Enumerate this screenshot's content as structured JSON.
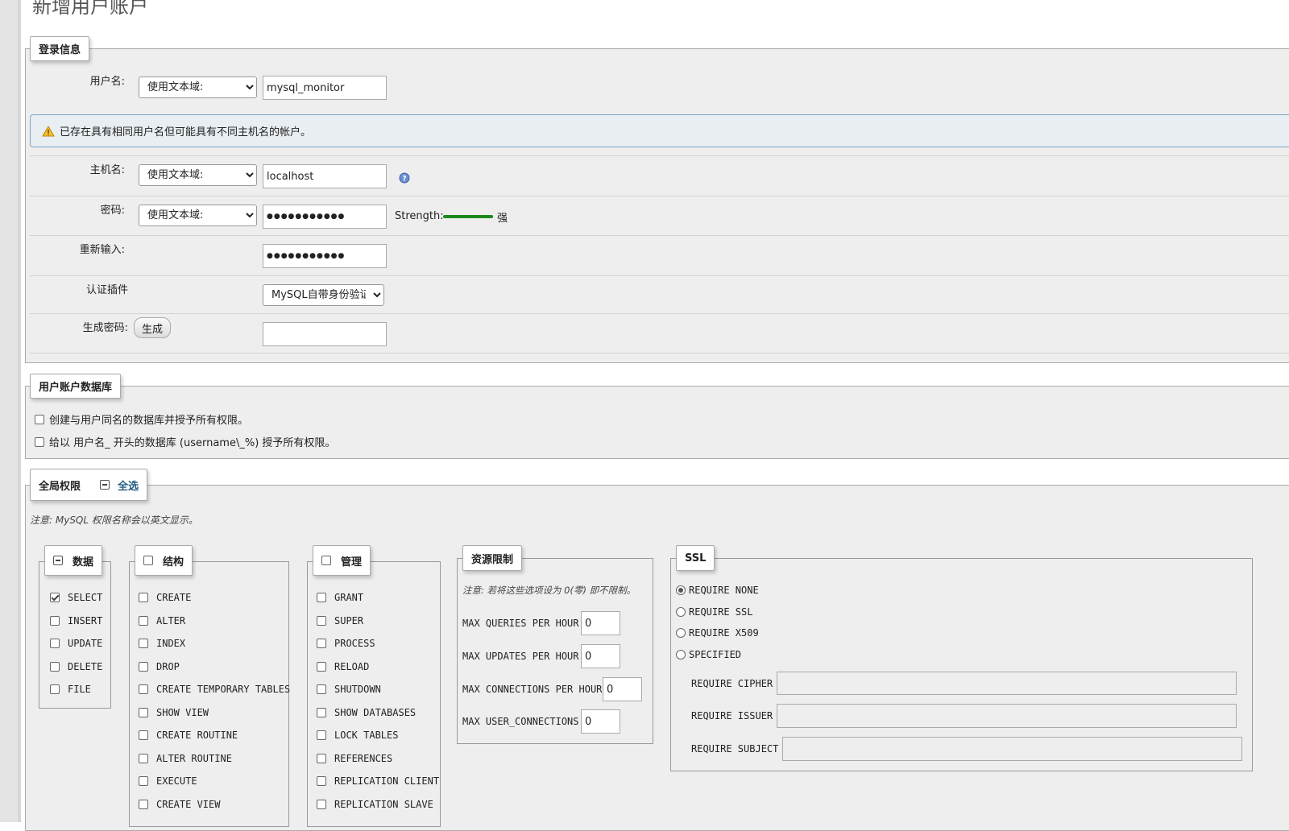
{
  "page": {
    "title": "新增用户账户"
  },
  "login": {
    "legend": "登录信息",
    "username_label": "用户名:",
    "username_mode": "使用文本域:",
    "username_value": "mysql_monitor",
    "warning_text": "已存在具有相同用户名但可能具有不同主机名的帐户。",
    "host_label": "主机名:",
    "host_mode": "使用文本域:",
    "host_value": "localhost",
    "password_label": "密码:",
    "password_mode": "使用文本域:",
    "password_value": "●●●●●●●●●●●",
    "strength_label": "Strength:",
    "strength_text": "强",
    "strength_color": "#1a8a1a",
    "retype_label": "重新输入:",
    "retype_value": "●●●●●●●●●●●",
    "auth_label": "认证插件",
    "auth_value": "MySQL自带身份验证",
    "gen_label": "生成密码:",
    "gen_button": "生成",
    "gen_value": ""
  },
  "userdb": {
    "legend": "用户账户数据库",
    "opt1": "创建与用户同名的数据库并授予所有权限。",
    "opt2": "给以 用户名_ 开头的数据库 (username\\_%) 授予所有权限。"
  },
  "global": {
    "legend": "全局权限",
    "select_all": "全选",
    "note": "注意: MySQL 权限名称会以英文显示。",
    "data": {
      "legend": "数据",
      "items": [
        {
          "label": "SELECT",
          "checked": true
        },
        {
          "label": "INSERT",
          "checked": false
        },
        {
          "label": "UPDATE",
          "checked": false
        },
        {
          "label": "DELETE",
          "checked": false
        },
        {
          "label": "FILE",
          "checked": false
        }
      ]
    },
    "structure": {
      "legend": "结构",
      "items": [
        "CREATE",
        "ALTER",
        "INDEX",
        "DROP",
        "CREATE TEMPORARY TABLES",
        "SHOW VIEW",
        "CREATE ROUTINE",
        "ALTER ROUTINE",
        "EXECUTE",
        "CREATE VIEW"
      ]
    },
    "admin": {
      "legend": "管理",
      "items": [
        "GRANT",
        "SUPER",
        "PROCESS",
        "RELOAD",
        "SHUTDOWN",
        "SHOW DATABASES",
        "LOCK TABLES",
        "REFERENCES",
        "REPLICATION CLIENT",
        "REPLICATION SLAVE"
      ]
    },
    "resources": {
      "legend": "资源限制",
      "note": "注意: 若将这些选项设为 0(零) 即不限制。",
      "items": [
        {
          "label": "MAX QUERIES PER HOUR",
          "value": "0"
        },
        {
          "label": "MAX UPDATES PER HOUR",
          "value": "0"
        },
        {
          "label": "MAX CONNECTIONS PER HOUR",
          "value": "0"
        },
        {
          "label": "MAX USER_CONNECTIONS",
          "value": "0"
        }
      ]
    },
    "ssl": {
      "legend": "SSL",
      "options": [
        {
          "label": "REQUIRE NONE",
          "selected": true
        },
        {
          "label": "REQUIRE SSL",
          "selected": false
        },
        {
          "label": "REQUIRE X509",
          "selected": false
        },
        {
          "label": "SPECIFIED",
          "selected": false
        }
      ],
      "fields": [
        "REQUIRE CIPHER",
        "REQUIRE ISSUER",
        "REQUIRE SUBJECT"
      ]
    }
  }
}
